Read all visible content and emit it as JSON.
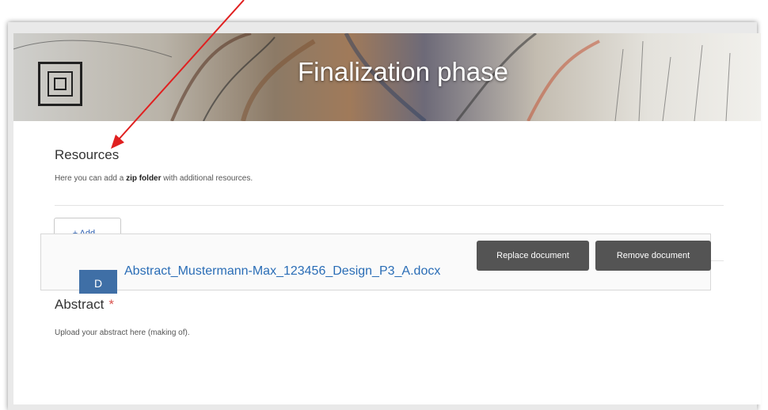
{
  "banner": {
    "title": "Finalization phase",
    "logo_icon": "logo-square-icon"
  },
  "resources": {
    "heading": "Resources",
    "description_prefix": "Here you can add a ",
    "description_bold": "zip folder",
    "description_suffix": " with additional resources.",
    "add_button": "+ Add..."
  },
  "abstract": {
    "heading": "Abstract",
    "required_marker": "*",
    "description": "Upload your abstract here (making of).",
    "replace_button": "Replace document",
    "remove_button": "Remove document",
    "file_icon_letter": "D",
    "file_name": "Abstract_Mustermann-Max_123456_Design_P3_A.docx"
  },
  "colors": {
    "accent": "#2a6db6",
    "required": "#d9534f",
    "button_dark": "#545454",
    "annotation_arrow": "#e02020"
  }
}
